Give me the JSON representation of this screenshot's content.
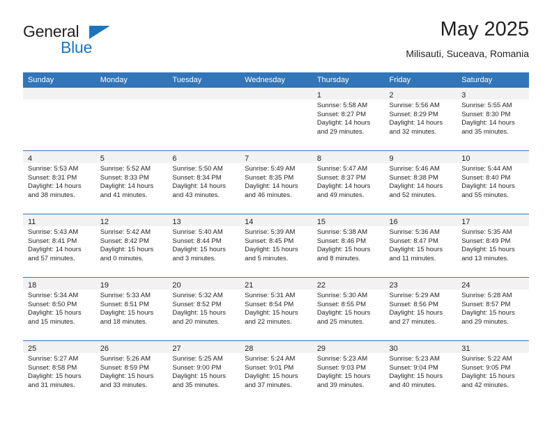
{
  "brand": {
    "name_part1": "General",
    "name_part2": "Blue",
    "accent_color": "#1c75bc",
    "triangle_icon": "triangle-icon"
  },
  "header": {
    "title": "May 2025",
    "location": "Milisauti, Suceava, Romania"
  },
  "theme": {
    "header_bg": "#3275b8",
    "daynum_band_bg": "#f2f2f2",
    "text_color": "#231f20",
    "grid_line": "#3275b8"
  },
  "calendar": {
    "weekday_headers": [
      "Sunday",
      "Monday",
      "Tuesday",
      "Wednesday",
      "Thursday",
      "Friday",
      "Saturday"
    ],
    "labels": {
      "sunrise": "Sunrise:",
      "sunset": "Sunset:",
      "daylight": "Daylight:"
    },
    "weeks": [
      [
        {
          "empty": true
        },
        {
          "empty": true
        },
        {
          "empty": true
        },
        {
          "empty": true
        },
        {
          "day": "1",
          "l1": "Sunrise: 5:58 AM",
          "l2": "Sunset: 8:27 PM",
          "l3": "Daylight: 14 hours",
          "l4": "and 29 minutes."
        },
        {
          "day": "2",
          "l1": "Sunrise: 5:56 AM",
          "l2": "Sunset: 8:29 PM",
          "l3": "Daylight: 14 hours",
          "l4": "and 32 minutes."
        },
        {
          "day": "3",
          "l1": "Sunrise: 5:55 AM",
          "l2": "Sunset: 8:30 PM",
          "l3": "Daylight: 14 hours",
          "l4": "and 35 minutes."
        }
      ],
      [
        {
          "day": "4",
          "l1": "Sunrise: 5:53 AM",
          "l2": "Sunset: 8:31 PM",
          "l3": "Daylight: 14 hours",
          "l4": "and 38 minutes."
        },
        {
          "day": "5",
          "l1": "Sunrise: 5:52 AM",
          "l2": "Sunset: 8:33 PM",
          "l3": "Daylight: 14 hours",
          "l4": "and 41 minutes."
        },
        {
          "day": "6",
          "l1": "Sunrise: 5:50 AM",
          "l2": "Sunset: 8:34 PM",
          "l3": "Daylight: 14 hours",
          "l4": "and 43 minutes."
        },
        {
          "day": "7",
          "l1": "Sunrise: 5:49 AM",
          "l2": "Sunset: 8:35 PM",
          "l3": "Daylight: 14 hours",
          "l4": "and 46 minutes."
        },
        {
          "day": "8",
          "l1": "Sunrise: 5:47 AM",
          "l2": "Sunset: 8:37 PM",
          "l3": "Daylight: 14 hours",
          "l4": "and 49 minutes."
        },
        {
          "day": "9",
          "l1": "Sunrise: 5:46 AM",
          "l2": "Sunset: 8:38 PM",
          "l3": "Daylight: 14 hours",
          "l4": "and 52 minutes."
        },
        {
          "day": "10",
          "l1": "Sunrise: 5:44 AM",
          "l2": "Sunset: 8:40 PM",
          "l3": "Daylight: 14 hours",
          "l4": "and 55 minutes."
        }
      ],
      [
        {
          "day": "11",
          "l1": "Sunrise: 5:43 AM",
          "l2": "Sunset: 8:41 PM",
          "l3": "Daylight: 14 hours",
          "l4": "and 57 minutes."
        },
        {
          "day": "12",
          "l1": "Sunrise: 5:42 AM",
          "l2": "Sunset: 8:42 PM",
          "l3": "Daylight: 15 hours",
          "l4": "and 0 minutes."
        },
        {
          "day": "13",
          "l1": "Sunrise: 5:40 AM",
          "l2": "Sunset: 8:44 PM",
          "l3": "Daylight: 15 hours",
          "l4": "and 3 minutes."
        },
        {
          "day": "14",
          "l1": "Sunrise: 5:39 AM",
          "l2": "Sunset: 8:45 PM",
          "l3": "Daylight: 15 hours",
          "l4": "and 5 minutes."
        },
        {
          "day": "15",
          "l1": "Sunrise: 5:38 AM",
          "l2": "Sunset: 8:46 PM",
          "l3": "Daylight: 15 hours",
          "l4": "and 8 minutes."
        },
        {
          "day": "16",
          "l1": "Sunrise: 5:36 AM",
          "l2": "Sunset: 8:47 PM",
          "l3": "Daylight: 15 hours",
          "l4": "and 11 minutes."
        },
        {
          "day": "17",
          "l1": "Sunrise: 5:35 AM",
          "l2": "Sunset: 8:49 PM",
          "l3": "Daylight: 15 hours",
          "l4": "and 13 minutes."
        }
      ],
      [
        {
          "day": "18",
          "l1": "Sunrise: 5:34 AM",
          "l2": "Sunset: 8:50 PM",
          "l3": "Daylight: 15 hours",
          "l4": "and 15 minutes."
        },
        {
          "day": "19",
          "l1": "Sunrise: 5:33 AM",
          "l2": "Sunset: 8:51 PM",
          "l3": "Daylight: 15 hours",
          "l4": "and 18 minutes."
        },
        {
          "day": "20",
          "l1": "Sunrise: 5:32 AM",
          "l2": "Sunset: 8:52 PM",
          "l3": "Daylight: 15 hours",
          "l4": "and 20 minutes."
        },
        {
          "day": "21",
          "l1": "Sunrise: 5:31 AM",
          "l2": "Sunset: 8:54 PM",
          "l3": "Daylight: 15 hours",
          "l4": "and 22 minutes."
        },
        {
          "day": "22",
          "l1": "Sunrise: 5:30 AM",
          "l2": "Sunset: 8:55 PM",
          "l3": "Daylight: 15 hours",
          "l4": "and 25 minutes."
        },
        {
          "day": "23",
          "l1": "Sunrise: 5:29 AM",
          "l2": "Sunset: 8:56 PM",
          "l3": "Daylight: 15 hours",
          "l4": "and 27 minutes."
        },
        {
          "day": "24",
          "l1": "Sunrise: 5:28 AM",
          "l2": "Sunset: 8:57 PM",
          "l3": "Daylight: 15 hours",
          "l4": "and 29 minutes."
        }
      ],
      [
        {
          "day": "25",
          "l1": "Sunrise: 5:27 AM",
          "l2": "Sunset: 8:58 PM",
          "l3": "Daylight: 15 hours",
          "l4": "and 31 minutes."
        },
        {
          "day": "26",
          "l1": "Sunrise: 5:26 AM",
          "l2": "Sunset: 8:59 PM",
          "l3": "Daylight: 15 hours",
          "l4": "and 33 minutes."
        },
        {
          "day": "27",
          "l1": "Sunrise: 5:25 AM",
          "l2": "Sunset: 9:00 PM",
          "l3": "Daylight: 15 hours",
          "l4": "and 35 minutes."
        },
        {
          "day": "28",
          "l1": "Sunrise: 5:24 AM",
          "l2": "Sunset: 9:01 PM",
          "l3": "Daylight: 15 hours",
          "l4": "and 37 minutes."
        },
        {
          "day": "29",
          "l1": "Sunrise: 5:23 AM",
          "l2": "Sunset: 9:03 PM",
          "l3": "Daylight: 15 hours",
          "l4": "and 39 minutes."
        },
        {
          "day": "30",
          "l1": "Sunrise: 5:23 AM",
          "l2": "Sunset: 9:04 PM",
          "l3": "Daylight: 15 hours",
          "l4": "and 40 minutes."
        },
        {
          "day": "31",
          "l1": "Sunrise: 5:22 AM",
          "l2": "Sunset: 9:05 PM",
          "l3": "Daylight: 15 hours",
          "l4": "and 42 minutes."
        }
      ]
    ]
  }
}
